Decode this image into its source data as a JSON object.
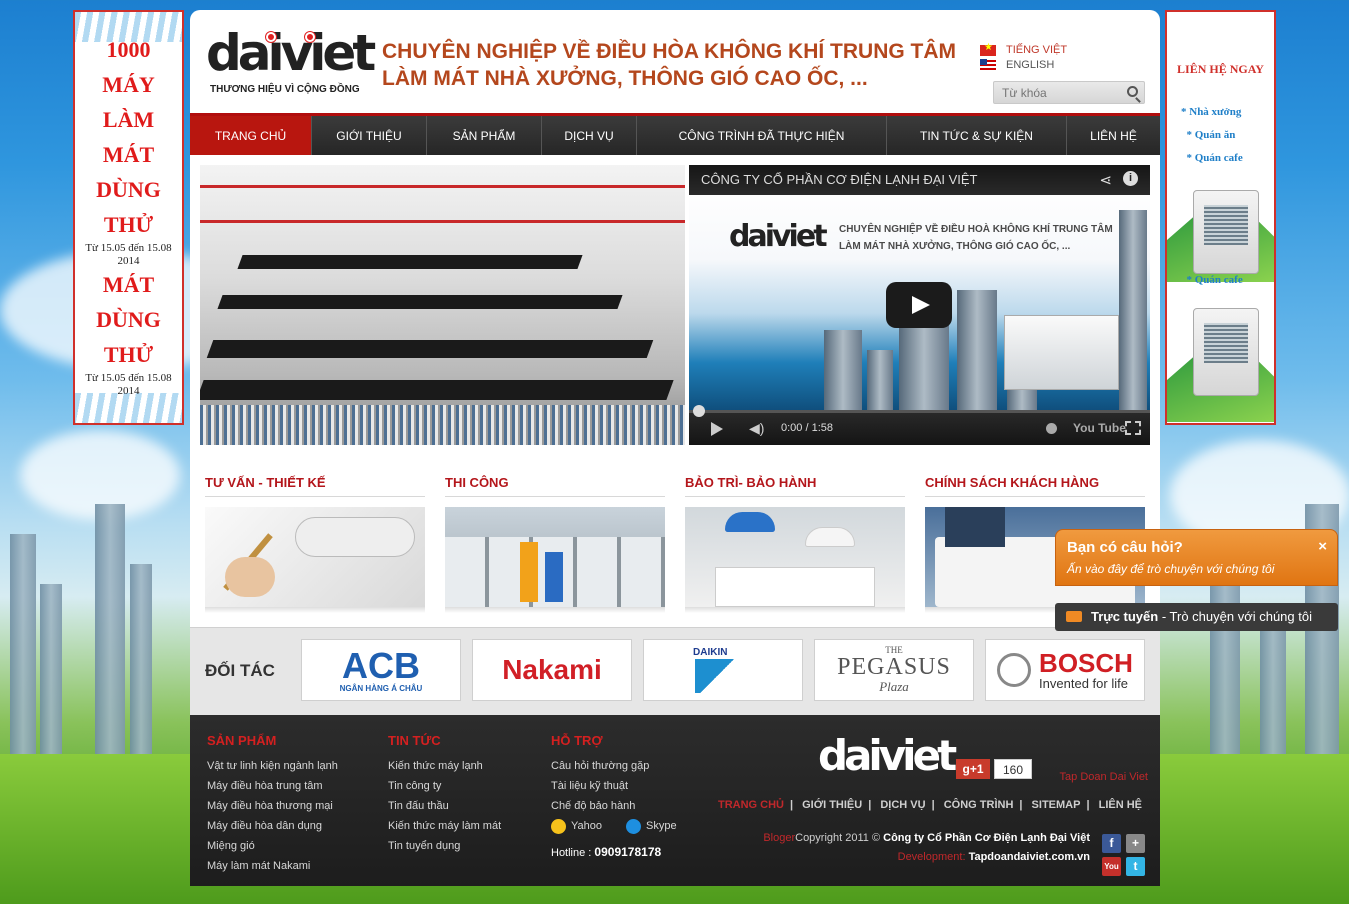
{
  "promo": {
    "number": "1000",
    "lines": [
      "MÁY",
      "LÀM",
      "MÁT",
      "DÙNG",
      "THỬ"
    ],
    "lines2": [
      "MÁT",
      "DÙNG",
      "THỬ"
    ],
    "date": "Từ 15.05 đến 15.08 2014"
  },
  "contact": {
    "title": "LIÊN HỆ NGAY",
    "items": [
      "Nhà xưởng",
      "Quán ăn",
      "Quán cafe"
    ],
    "extra": "Quán cafe"
  },
  "header": {
    "logo": "daiviet",
    "tagline": "THƯƠNG HIỆU VÌ CỘNG ĐỒNG",
    "headline1": "CHUYÊN NGHIỆP VỀ ĐIỀU HÒA KHÔNG KHÍ TRUNG TÂM",
    "headline2": "LÀM MÁT NHÀ XƯỞNG, THÔNG GIÓ CAO ỐC, ...",
    "lang_vi": "TIẾNG VIỆT",
    "lang_en": "ENGLISH",
    "search_placeholder": "Từ khóa"
  },
  "nav": {
    "items": [
      "TRANG CHỦ",
      "GIỚI THIỆU",
      "SẢN PHẨM",
      "DỊCH VỤ",
      "CÔNG TRÌNH ĐÃ THỰC HIỆN",
      "TIN TỨC & SỰ KIỆN",
      "LIÊN HỆ"
    ]
  },
  "video": {
    "title": "CÔNG TY CỔ PHẦN CƠ ĐIỆN LẠNH ĐẠI VIỆT",
    "logo": "daiviet",
    "text1": "CHUYÊN NGHIỆP VỀ ĐIỀU HOÀ KHÔNG KHÍ TRUNG TÂM",
    "text2": "LÀM MÁT NHÀ XƯỞNG, THÔNG GIÓ CAO ỐC, ...",
    "time": "0:00 / 1:58",
    "youtube": "You Tube"
  },
  "services": [
    "TƯ VẤN - THIẾT KẾ",
    "THI CÔNG",
    "BẢO TRÌ- BẢO HÀNH",
    "CHÍNH SÁCH KHÁCH HÀNG"
  ],
  "partners": {
    "label": "ĐỐI TÁC",
    "acb": "ACB",
    "acb_sub": "NGÂN HÀNG Á CHÂU",
    "nakami": "Nakami",
    "daikin": "DAIKIN",
    "pegasus_the": "THE",
    "pegasus": "PEGASUS",
    "pegasus_plaza": "Plaza",
    "bosch": "BOSCH",
    "bosch_sub": "Invented for life"
  },
  "footer": {
    "col1": {
      "title": "SẢN PHẨM",
      "links": [
        "Vật tư linh kiện ngành lạnh",
        "Máy điều hòa trung tâm",
        "Máy điều hòa thương mại",
        "Máy điều hòa dân dụng",
        "Miệng gió",
        "Máy làm mát Nakami"
      ]
    },
    "col2": {
      "title": "TIN TỨC",
      "links": [
        "Kiến thức máy lạnh",
        "Tin công ty",
        "Tin đấu thầu",
        "Kiến thức máy làm mát",
        "Tin tuyển dụng"
      ]
    },
    "col3": {
      "title": "HỖ TRỢ",
      "links": [
        "Câu hỏi thường gặp",
        "Tài liệu kỹ thuật",
        "Chế độ bảo hành"
      ],
      "yahoo": "Yahoo",
      "skype": "Skype",
      "hotline_label": "Hotline :",
      "hotline": "0909178178"
    },
    "logo": "daiviet",
    "gplus": "g+1",
    "gplus_count": "160",
    "group": "Tap Doan Dai Viet",
    "nav": [
      "TRANG CHỦ",
      "GIỚI THIỆU",
      "DỊCH VỤ",
      "CÔNG TRÌNH",
      "SITEMAP",
      "LIÊN HỆ"
    ],
    "bloger": "Bloger",
    "copyright": "Copyright 2011 ©",
    "company": "Công ty Cổ Phần Cơ Điện Lạnh Đại Việt",
    "dev_label": "Development:",
    "dev_site": "Tapdoandaiviet.com.vn"
  },
  "chat": {
    "title": "Bạn có câu hỏi?",
    "subtitle": "Ấn vào đây để trò chuyện với chúng tôi",
    "close": "×",
    "bar_bold": "Trực tuyến",
    "bar_text": " - Trò chuyện với chúng tôi"
  }
}
